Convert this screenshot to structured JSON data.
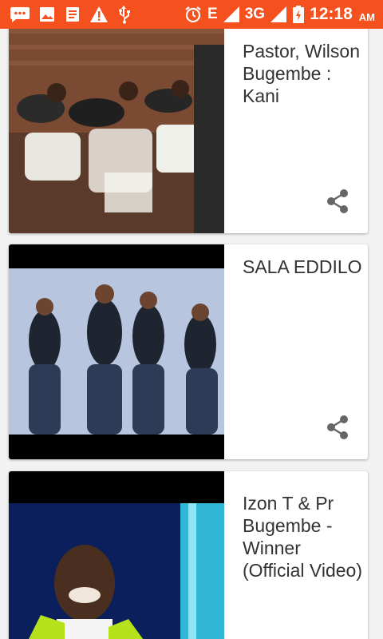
{
  "status_bar": {
    "network_type": "E",
    "network_type_2": "3G",
    "time": "12:18",
    "ampm": "AM",
    "icons": [
      "message-icon",
      "image-icon",
      "document-icon",
      "warning-icon",
      "usb-icon",
      "alarm-icon",
      "signal-icon",
      "signal-icon",
      "battery-icon"
    ]
  },
  "videos": [
    {
      "title": "Pastor, Wilson Bugembe : Kani",
      "share_icon": "share-icon"
    },
    {
      "title": "SALA EDDILO",
      "share_icon": "share-icon"
    },
    {
      "title": "Izon T & Pr Bugembe - Winner (Official Video)",
      "share_icon": "share-icon"
    }
  ],
  "colors": {
    "status_bar": "#f4511e",
    "card_background": "#ffffff",
    "list_background": "#f2f2f2",
    "title_text": "#333333",
    "share_icon": "#666666"
  }
}
